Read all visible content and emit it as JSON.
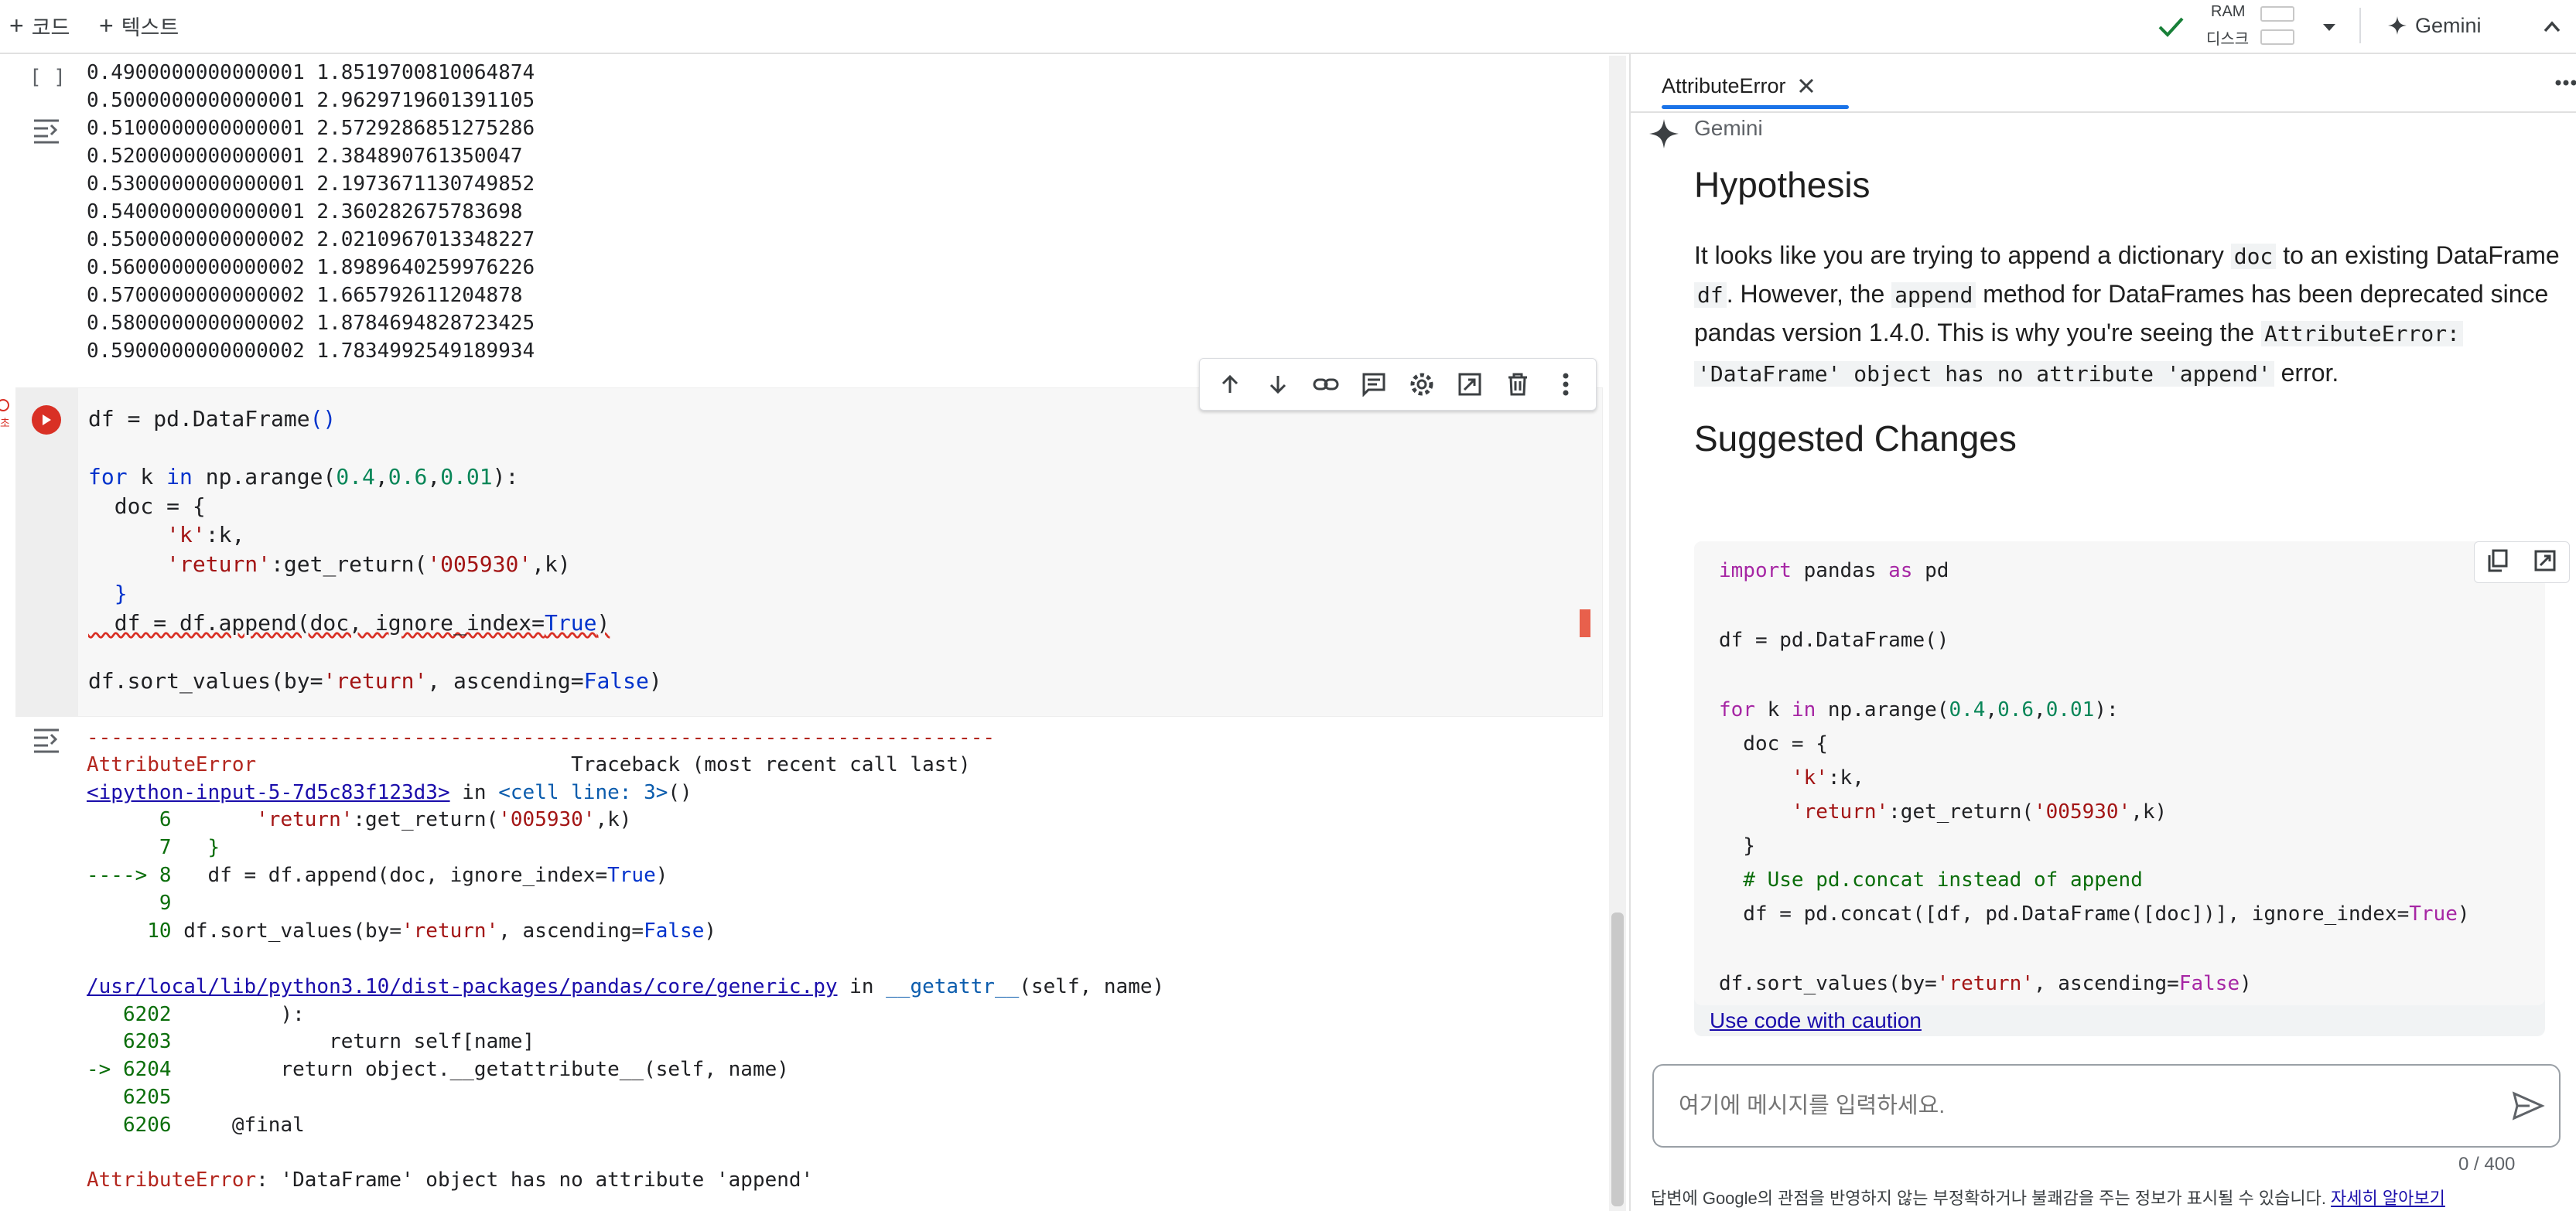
{
  "toolbar": {
    "add_code": "코드",
    "add_text": "텍스트",
    "ram_label": "RAM",
    "disk_label": "디스크",
    "gemini_label": "Gemini"
  },
  "output_prev": {
    "lines": [
      "0.4900000000000001 1.8519700810064874",
      "0.5000000000000001 2.9629719601391105",
      "0.5100000000000001 2.5729286851275286",
      "0.5200000000000001 2.384890761350047",
      "0.5300000000000001 2.1973671130749852",
      "0.5400000000000001 2.360282675783698",
      "0.5500000000000002 2.0210967013348227",
      "0.5600000000000002 1.8989640259976226",
      "0.5700000000000002 1.665792611204878",
      "0.5800000000000002 1.8784694828723425",
      "0.5900000000000002 1.7834992549189934"
    ],
    "bracket": "[ ]"
  },
  "code": {
    "l1": "df = pd.DataFrame",
    "l1b": "()",
    "l3a": "for",
    "l3b": " k ",
    "l3c": "in",
    "l3d": " np.arange(",
    "l3e": "0.4",
    "l3f": ",",
    "l3g": "0.6",
    "l3h": ",",
    "l3i": "0.01",
    "l3j": "):",
    "l4": "  doc = {",
    "l5a": "      ",
    "l5b": "'k'",
    "l5c": ":k,",
    "l6a": "      ",
    "l6b": "'return'",
    "l6c": ":get_return(",
    "l6d": "'005930'",
    "l6e": ",k)",
    "l7": "  }",
    "l8a": "  df = df.append(doc, ignore_index=",
    "l8b": "True",
    "l8c": ")",
    "l10a": "df.sort_values(by=",
    "l10b": "'return'",
    "l10c": ", ascending=",
    "l10d": "False",
    "l10e": ")"
  },
  "traceback": {
    "dashes": "---------------------------------------------------------------------------",
    "err_name": "AttributeError",
    "tb_title": "                          Traceback (most recent call last)",
    "input_link": "<ipython-input-5-7d5c83f123d3>",
    "in_word": " in ",
    "cell_line": "<cell line: 3>",
    "cell_paren": "()",
    "r6a": "      6       ",
    "r6b": "'return'",
    "r6c": ":get_return(",
    "r6d": "'005930'",
    "r6e": ",k)",
    "r7": "      7   }",
    "r8a": "----> 8",
    "r8b": "   df = df.append(doc, ignore_index=",
    "r8c": "True",
    "r8d": ")",
    "r9": "      9 ",
    "r10a": "     10 ",
    "r10b": "df.sort_values(by=",
    "r10c": "'return'",
    "r10d": ", ascending=",
    "r10e": "False",
    "r10f": ")",
    "file_link": "/usr/local/lib/python3.10/dist-packages/pandas/core/generic.py",
    "in_word2": " in ",
    "func": "__getattr__",
    "func_args": "(self, name)",
    "g1a": "   6202",
    "g1b": "         ):",
    "g2a": "   6203",
    "g2b": "             return self[name]",
    "g3a": "-> 6204",
    "g3b": "         return object.__getattribute__(self, name)",
    "g4a": "   6205",
    "g5a": "   6206",
    "g5b": "     @final",
    "final_err": "AttributeError",
    "final_msg": ": 'DataFrame' object has no attribute 'append'"
  },
  "panel": {
    "tab_label": "AttributeError",
    "gemini_name": "Gemini",
    "hypothesis_title": "Hypothesis",
    "p1_a": "It looks like you are trying to append a dictionary ",
    "p1_doc": "doc",
    "p1_b": " to an existing DataFrame",
    "p2_df": "df",
    "p2_a": ". However, the ",
    "p2_append": "append",
    "p2_b": " method for DataFrames has been deprecated since",
    "p3_a": "pandas version 1.4.0. This is why you're seeing the ",
    "p3_err": "AttributeError:",
    "p4_code": "'DataFrame' object has no attribute 'append'",
    "p4_b": " error.",
    "suggested_title": "Suggested Changes",
    "code_lines": {
      "c1a": "import",
      "c1b": " pandas ",
      "c1c": "as",
      "c1d": " pd",
      "c2": "df = pd.DataFrame()",
      "c3a": "for",
      "c3b": " k ",
      "c3c": "in",
      "c3d": " np.arange(",
      "c3e": "0.4",
      "c3f": ",",
      "c3g": "0.6",
      "c3h": ",",
      "c3i": "0.01",
      "c3j": "):",
      "c4": "  doc = {",
      "c5a": "      ",
      "c5b": "'k'",
      "c5c": ":k,",
      "c6a": "      ",
      "c6b": "'return'",
      "c6c": ":get_return(",
      "c6d": "'005930'",
      "c6e": ",k)",
      "c7": "  }",
      "c8": "  # Use pd.concat instead of append",
      "c9a": "  df = pd.concat([df, pd.DataFrame([doc])], ignore_index=",
      "c9b": "True",
      "c9c": ")",
      "c10a": "df.sort_values(by=",
      "c10b": "'return'",
      "c10c": ", ascending=",
      "c10d": "False",
      "c10e": ")"
    },
    "use_with_caution": "Use code with caution",
    "input_placeholder": "여기에 메시지를 입력하세요.",
    "char_count": "0 / 400",
    "disclaimer": "답변에 Google의 관점을 반영하지 않는 부정확하거나 불쾌감을 주는 정보가 표시될 수 있습니다. ",
    "learn_more": "자세히 알아보기"
  },
  "colors": {
    "accent": "#1a73e8",
    "run_button": "#d93025",
    "error_red": "#b3261e"
  }
}
